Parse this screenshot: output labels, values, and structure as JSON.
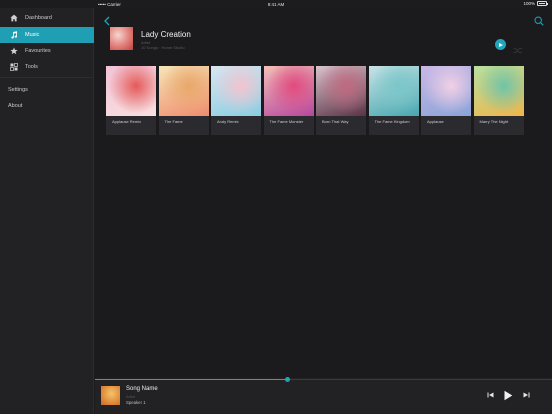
{
  "status_bar": {
    "carrier": "••••• Carrier",
    "time": "9:41 AM",
    "battery": "100%"
  },
  "sidebar": {
    "items": [
      {
        "label": "Dashboard",
        "icon": "home-icon"
      },
      {
        "label": "Music",
        "icon": "music-note-icon",
        "active": true
      },
      {
        "label": "Favourites",
        "icon": "star-icon"
      },
      {
        "label": "Tools",
        "icon": "tools-icon"
      }
    ],
    "secondary": [
      {
        "label": "Settings"
      },
      {
        "label": "About"
      }
    ]
  },
  "album": {
    "title": "Lady Creation",
    "subtitle": "Artist",
    "meta": "10 Songs · Home Studio"
  },
  "tracks": [
    {
      "title": "Applause Remix",
      "colors": [
        "#f1c3d6",
        "#e45a58",
        "#f8e0e0"
      ]
    },
    {
      "title": "The Fame",
      "colors": [
        "#f5e6b8",
        "#e9a86a",
        "#f08c6f"
      ]
    },
    {
      "title": "Andy Remix",
      "colors": [
        "#d8e6f2",
        "#f2c4cf",
        "#8bcde0"
      ]
    },
    {
      "title": "The Fame Monster",
      "colors": [
        "#f2c1b8",
        "#e24a7d",
        "#b6479e"
      ]
    },
    {
      "title": "Born That Way",
      "colors": [
        "#d9c4cc",
        "#c06880",
        "#5a3346"
      ]
    },
    {
      "title": "The Fame Kingdom",
      "colors": [
        "#c9e3e6",
        "#7ac7c9",
        "#48a7b0"
      ]
    },
    {
      "title": "Applause",
      "colors": [
        "#c9b8e6",
        "#f1d0e6",
        "#8aa4d8"
      ]
    },
    {
      "title": "Marry The Night",
      "colors": [
        "#b7e1a1",
        "#6fc4a8",
        "#f0b54a"
      ]
    }
  ],
  "now_playing": {
    "title": "Song Name",
    "artist": "Artist",
    "output": "Speaker 1",
    "progress": 0.42
  },
  "colors": {
    "accent": "#1fa6bb",
    "background": "#1b1b1e",
    "sidebar": "#222225"
  }
}
